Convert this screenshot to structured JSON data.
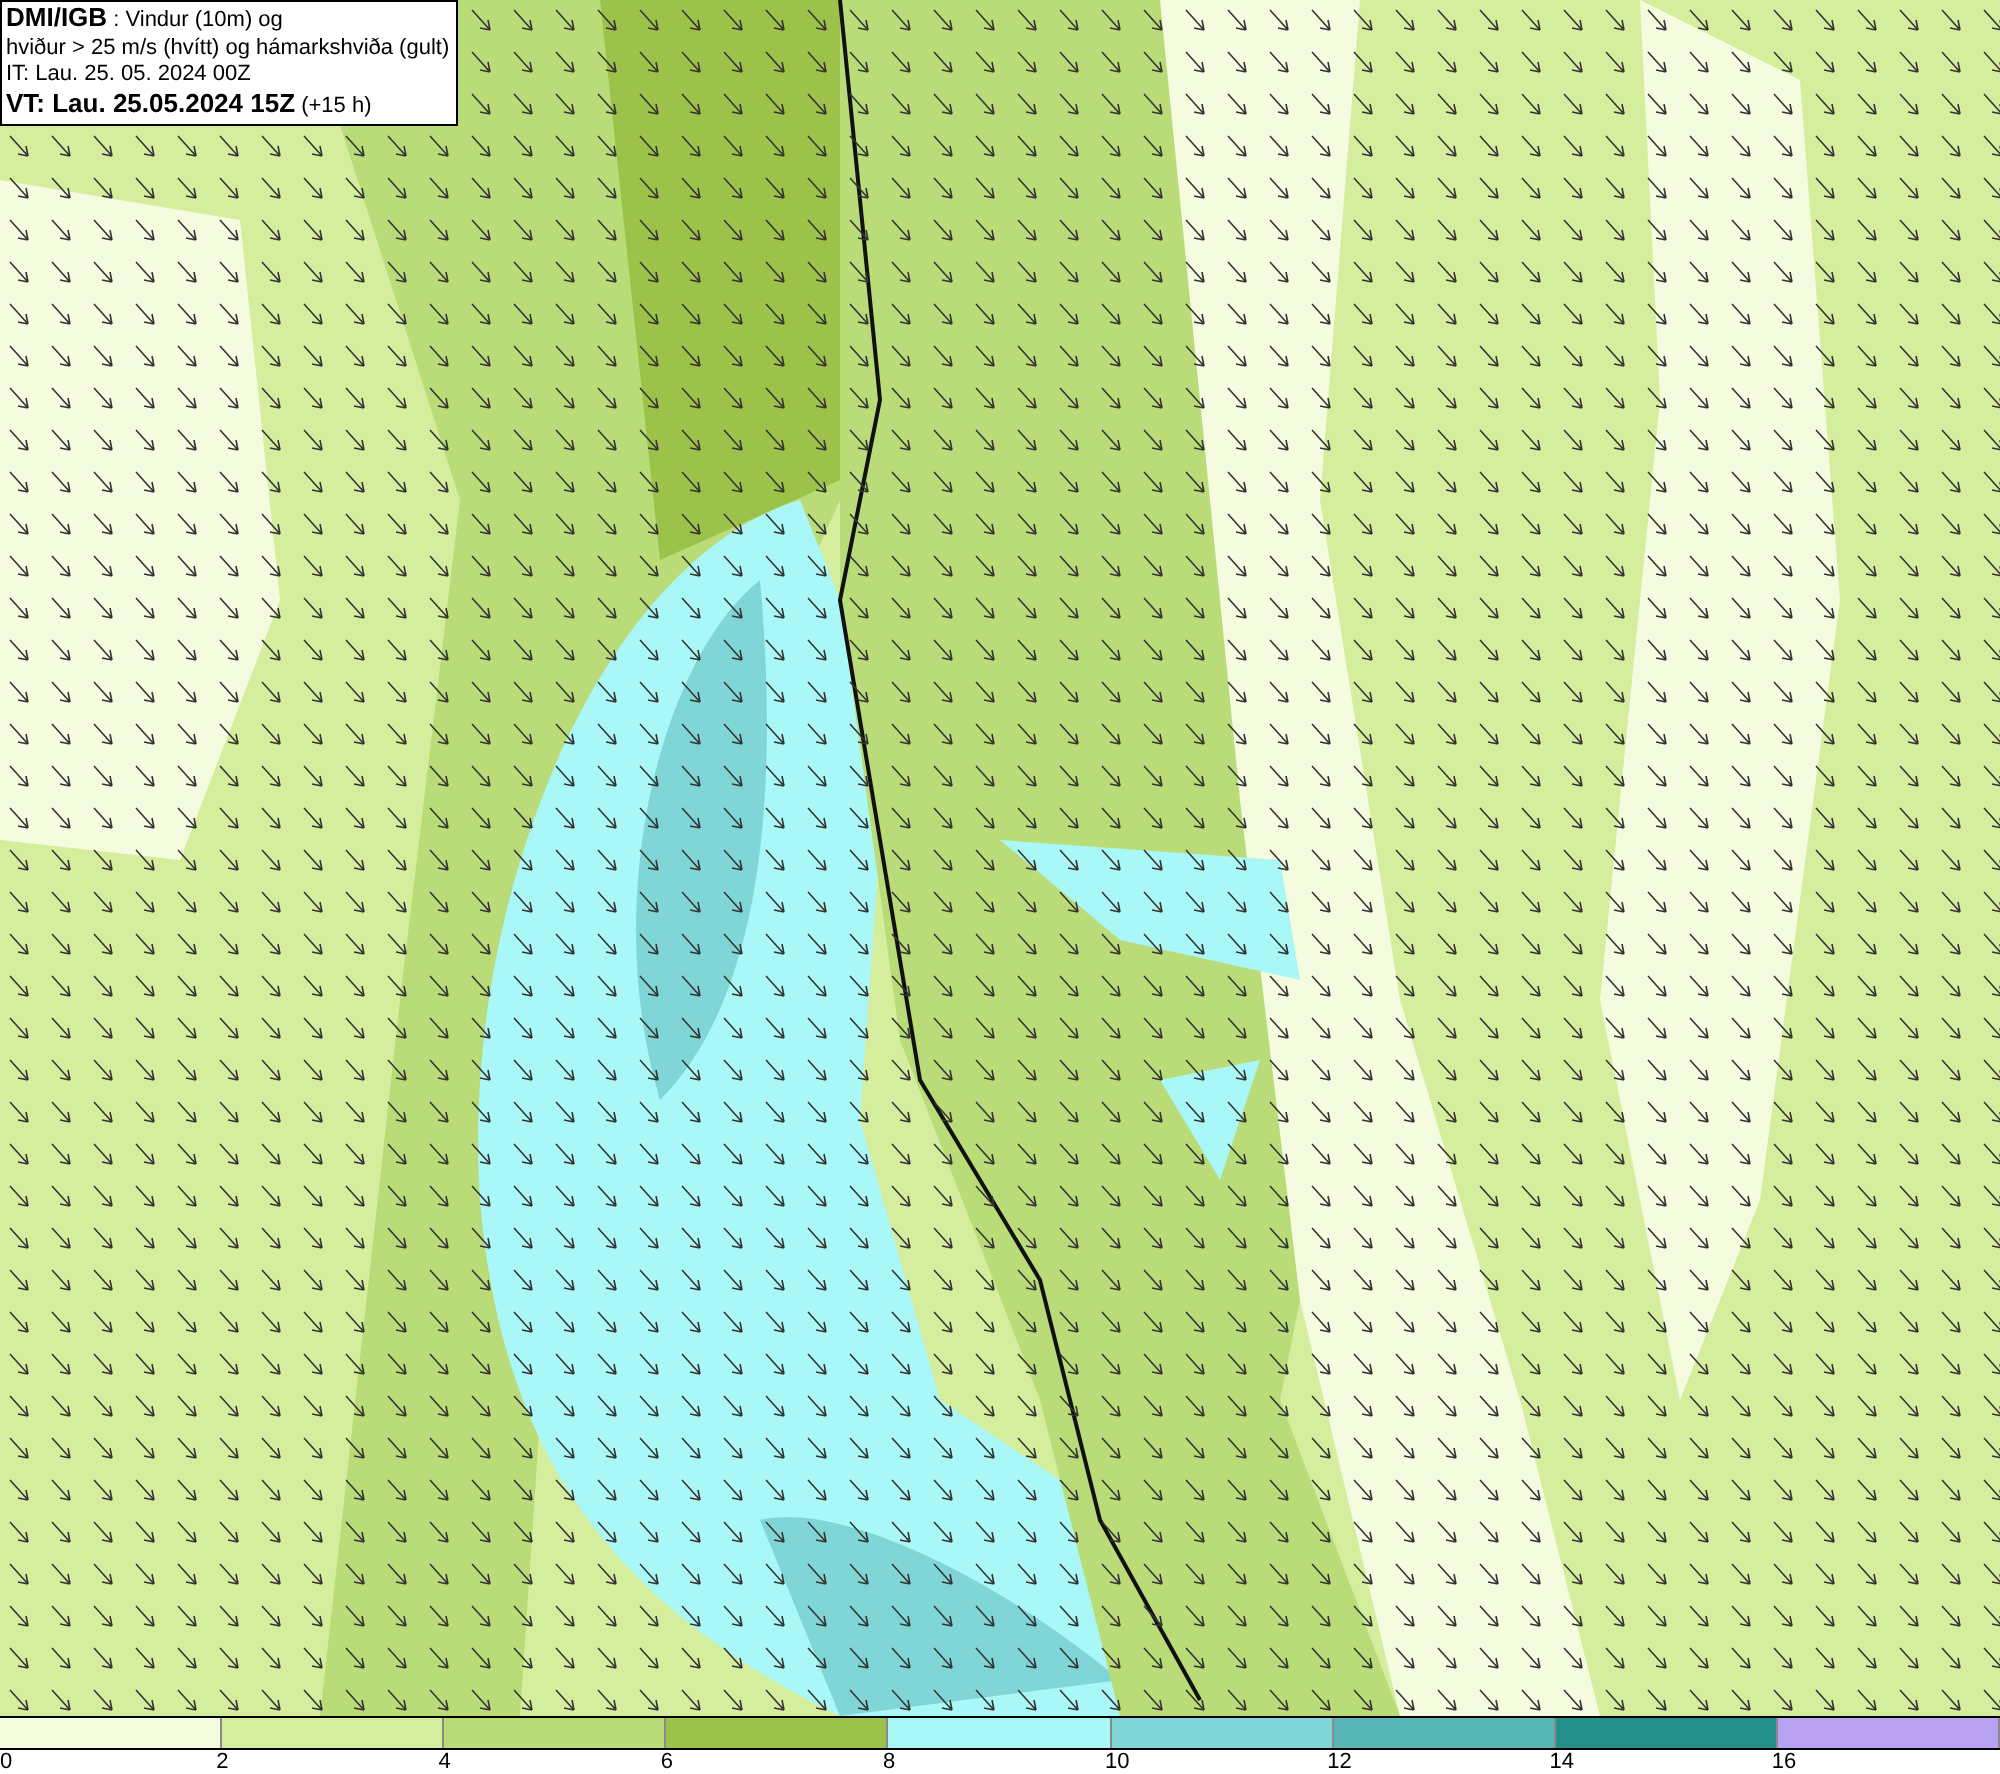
{
  "title_box": {
    "lines": [
      "**DMI/IGB** : Vindur (10m) og",
      "hviður > 25 m/s (hvítt) og hámarkshviða (gult)",
      "IT: Lau. 25. 05. 2024 00Z",
      "**VT: Lau. 25.05.2024 15Z** (+15 h)"
    ]
  },
  "legend": {
    "bins": [
      {
        "color": "#f4fbdf",
        "label": "0"
      },
      {
        "color": "#d5ee9e",
        "label": "2"
      },
      {
        "color": "#b9dc78",
        "label": "4"
      },
      {
        "color": "#9cc24a",
        "label": "6"
      },
      {
        "color": "#aaf7f7",
        "label": "8"
      },
      {
        "color": "#80d6d6",
        "label": "10"
      },
      {
        "color": "#58b6b4",
        "label": "12"
      },
      {
        "color": "#259089",
        "label": "14"
      },
      {
        "color": "#b9a2f2",
        "label": "16"
      }
    ]
  }
}
